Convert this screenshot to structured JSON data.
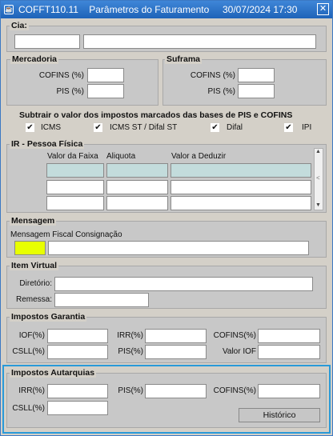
{
  "window": {
    "title": "COFFT110.11    Parâmetros do Faturamento     30/07/2024 17:30",
    "icon": "oracle-forms-icon",
    "close": "✕"
  },
  "cia": {
    "legend": "Cia:"
  },
  "mercadoria": {
    "legend": "Mercadoria",
    "cofins_label": "COFINS (%)",
    "pis_label": "PIS (%)"
  },
  "suframa": {
    "legend": "Suframa",
    "cofins_label": "COFINS (%)",
    "pis_label": "PIS (%)"
  },
  "subtrair": {
    "title": "Subtrair o valor dos impostos marcados das bases de PIS e COFINS",
    "options": [
      {
        "label": "ICMS",
        "checked": true
      },
      {
        "label": "ICMS ST / Difal ST",
        "checked": true
      },
      {
        "label": "Difal",
        "checked": true
      },
      {
        "label": "IPI",
        "checked": true
      }
    ],
    "check_glyph": "✔"
  },
  "ir": {
    "legend": "IR - Pessoa Física",
    "columns": [
      "Valor da Faixa",
      "Aliquota",
      "Valor a Deduzir"
    ],
    "scroll_up": "▲",
    "scroll_down": "▼",
    "scroll_mark": "<"
  },
  "mensagem": {
    "legend": "Mensagem",
    "label": "Mensagem Fiscal Consignação"
  },
  "item_virtual": {
    "legend": "Item Virtual",
    "diretorio_label": "Diretório:",
    "remessa_label": "Remessa:"
  },
  "garantia": {
    "legend": "Impostos Garantia",
    "iof_label": "IOF(%)",
    "irr_label": "IRR(%)",
    "cofins_label": "COFINS(%)",
    "csll_label": "CSLL(%)",
    "pis_label": "PIS(%)",
    "valor_iof_label": "Valor IOF"
  },
  "autarquias": {
    "legend": "Impostos Autarquias",
    "irr_label": "IRR(%)",
    "pis_label": "PIS(%)",
    "cofins_label": "COFINS(%)",
    "csll_label": "CSLL(%)",
    "historico_button": "Histórico",
    "highlight_color": "#2a9ad8"
  }
}
